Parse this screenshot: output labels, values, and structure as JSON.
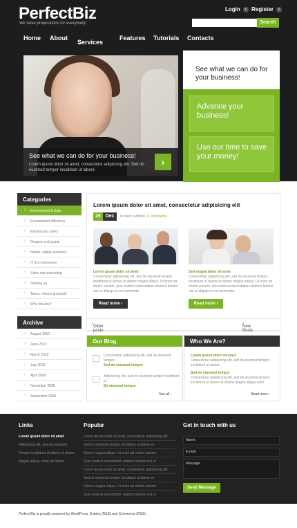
{
  "header": {
    "logo_part1": "Perfect",
    "logo_part2": "Biz",
    "tagline": "We have propositions for everybody!",
    "login": "Login",
    "register": "Register",
    "search_button": "Search"
  },
  "nav": [
    "Home",
    "About",
    "Services",
    "Features",
    "Tutorials",
    "Contacts"
  ],
  "hero": {
    "caption_title": "See what we can do for your business!",
    "caption_text": "Lorem ipsum dolor sit amet, consectetur adipiscing elit. Sed do eiusmod tempor incididunt ut labore",
    "side_title": "See what we can do for your business!",
    "box1": "Advance your business!",
    "box2": "Use our time to save your money!"
  },
  "categories": {
    "title": "Categories",
    "items": [
      "Environment & data",
      "Environment efficiency",
      "Exploit your users",
      "Finance and grants",
      "Health, safety premises",
      "IT & e-commerce",
      "Sales and marketing",
      "Starting up",
      "Taxes, returns & payroll",
      "Who We Are?"
    ]
  },
  "archive": {
    "title": "Archive",
    "items": [
      "August 2010",
      "June 2010",
      "March 2010",
      "July 2009",
      "April 2009",
      "November 2008",
      "September 2008"
    ]
  },
  "post": {
    "title": "Lorem ipsum dolor sit amet, consectetur adipisicing elit",
    "day": "26",
    "month": "Dec",
    "meta_prefix": "Posted in Admin",
    "meta_comments": "0 Comments",
    "col1_link": "Lorem ipsum dolor sit amet",
    "col1_text": "Consectetur adipisicing elit, sed do eiusmod tempor incididunt ut labore et dolore magna aliqua. Ut enim ad minim veniam, quis nostrud exercitation ullamco laboris nisi ut aliquip ex ea commodo.",
    "col2_link": "Sed magna dolor sit amet",
    "col2_text": "Consectetur adipisicing elit, sed do eiusmod tempor incididunt ut labore et dolore magna aliqua. Ut enim ad minim veniam, quis nostrud exercitation ullamco laboris nisi ut aliquip ex ea commodo.",
    "read_more": "Read more"
  },
  "pager": {
    "older": "Older posts",
    "newer": "New Posts"
  },
  "blog": {
    "title": "Our Blog",
    "item1_text": "Consectetur adipisicing elit, sed do eiusmod tempor",
    "item1_link": "Sed do eiusmod tempor",
    "item2_text": "Adipisicing elit, sed do eiusmod tempor incididunt ut",
    "item2_link": "Do eiusmod tempor",
    "see_all": "See all"
  },
  "who": {
    "title": "Who We Are?",
    "link1": "Lorem ipsum dolor sit amet",
    "text1": "Consectetur adipisicing elit, sed do eiusmod tempor incididunt ut labore",
    "link2": "Sed do eiusmod tempor",
    "text2": "Consectetur adipisicing elit, sed do eiusmod tempor incididunt ut labore et dolore magna aliqua enim",
    "read_more": "Read more"
  },
  "footer": {
    "links_title": "Links",
    "links": [
      "Lorem ipsum dolor sit amet",
      "Adipisicing elit, sed do eiusmod",
      "Tempor incididunt ut labore et dolore",
      "Magna aliqua, enim ad minim"
    ],
    "popular_title": "Popular",
    "popular": [
      "Lorem ipsum dolor sit amet, consectetur adipisicing elit",
      "Sed do eiusmod tempor incididunt ut labore et",
      "Dolore magna aliqua. Ut enim ad minim veniam",
      "Quis nostrud exercitation ullamco laboris nisi ut",
      "Lorem ipsum dolor sit amet, consectetur adipisicing elit",
      "Sed do eiusmod tempor incididunt ut labore et",
      "Dolore magna aliqua. Ut enim ad minim veniam",
      "Quis nostrud exercitation ullamco laboris nisi ut"
    ],
    "contact_title": "Get in touch with us",
    "name_label": "Name:",
    "email_label": "E-mail:",
    "message_label": "Message:",
    "send": "Send Message",
    "copyright": "Perfect Biz is proudly powered by WordPress. Entries (RSS) and Comments (RSS)."
  },
  "colors": {
    "accent": "#7bb424",
    "dark": "#1d1d1d"
  }
}
